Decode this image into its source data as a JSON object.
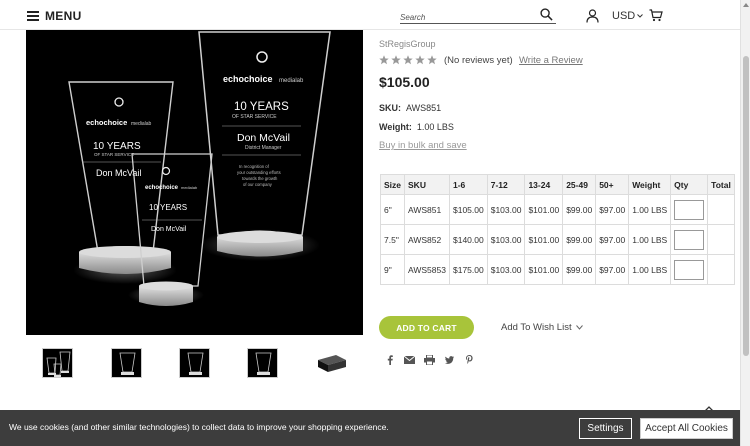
{
  "header": {
    "menu_label": "MENU",
    "search_placeholder": "Search",
    "currency": "USD"
  },
  "product": {
    "brand": "StRegisGroup",
    "reviews_text": "(No reviews yet)",
    "write_review": "Write a Review",
    "price": "$105.00",
    "sku_label": "SKU:",
    "sku_value": "AWS851",
    "weight_label": "Weight:",
    "weight_value": "1.00 LBS",
    "bulk_link": "Buy in bulk and save"
  },
  "artwork": {
    "brand_text": "echochoice",
    "brand_sub": "medialab",
    "years": "10 YEARS",
    "service": "OF STAR SERVICE",
    "name": "Don McVail",
    "role": "District Manager",
    "caption_1": "In recognition of",
    "caption_2": "your outstanding efforts",
    "caption_3": "towards the growth",
    "caption_4": "of our company"
  },
  "pricing_table": {
    "headers": [
      "Size",
      "SKU",
      "1-6",
      "7-12",
      "13-24",
      "25-49",
      "50+",
      "Weight",
      "Qty",
      "Total"
    ],
    "rows": [
      [
        "6\"",
        "AWS851",
        "$105.00",
        "$103.00",
        "$101.00",
        "$99.00",
        "$97.00",
        "1.00 LBS"
      ],
      [
        "7.5\"",
        "AWS852",
        "$140.00",
        "$103.00",
        "$101.00",
        "$99.00",
        "$97.00",
        "1.00 LBS"
      ],
      [
        "9\"",
        "AWS5853",
        "$175.00",
        "$103.00",
        "$101.00",
        "$99.00",
        "$97.00",
        "1.00 LBS"
      ]
    ]
  },
  "actions": {
    "add_to_cart": "ADD TO CART",
    "wishlist": "Add To Wish List"
  },
  "cookie": {
    "text": "We use cookies (and other similar technologies) to collect data to improve your shopping experience.",
    "settings": "Settings",
    "accept": "Accept All Cookies"
  },
  "colors": {
    "accent": "#a8c43a",
    "cookie_bg": "#3d3d3d"
  }
}
